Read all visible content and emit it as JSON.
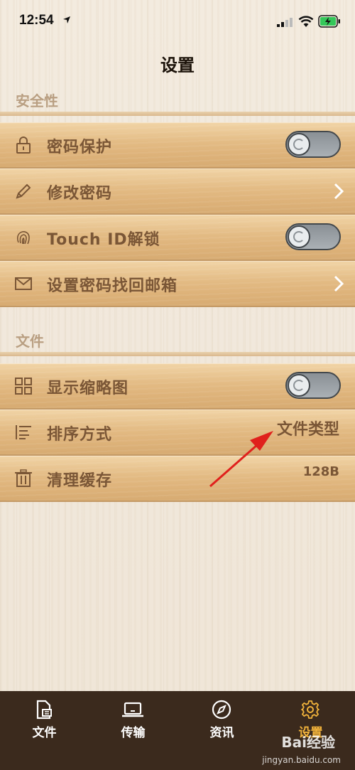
{
  "status_bar": {
    "time": "12:54"
  },
  "page_title": "设置",
  "sections": [
    {
      "header": "安全性",
      "rows": [
        {
          "label": "密码保护",
          "control": "toggle",
          "on": false,
          "icon": "lock-icon"
        },
        {
          "label": "修改密码",
          "control": "chevron",
          "icon": "pencil-icon"
        },
        {
          "label": "Touch ID解锁",
          "control": "toggle",
          "on": false,
          "icon": "fingerprint-icon"
        },
        {
          "label": "设置密码找回邮箱",
          "control": "chevron",
          "icon": "mail-icon"
        }
      ]
    },
    {
      "header": "文件",
      "rows": [
        {
          "label": "显示缩略图",
          "control": "toggle",
          "on": false,
          "icon": "grid-icon"
        },
        {
          "label": "排序方式",
          "control": "value",
          "value": "文件类型",
          "icon": "sort-list-icon"
        },
        {
          "label": "清理缓存",
          "control": "value",
          "value": "128B",
          "icon": "trash-icon"
        }
      ]
    }
  ],
  "tab_bar": {
    "tabs": [
      {
        "label": "文件",
        "icon": "file-icon",
        "active": false
      },
      {
        "label": "传输",
        "icon": "laptop-icon",
        "active": false
      },
      {
        "label": "资讯",
        "icon": "compass-icon",
        "active": false
      },
      {
        "label": "设置",
        "icon": "gear-icon",
        "active": true
      }
    ]
  },
  "watermark": {
    "brand": "Bai经验",
    "url": "jingyan.baidu.com"
  },
  "colors": {
    "tab_bar_bg": "#3b2a1d",
    "tab_active": "#f2b33b",
    "annotation_arrow": "#e0201c"
  }
}
